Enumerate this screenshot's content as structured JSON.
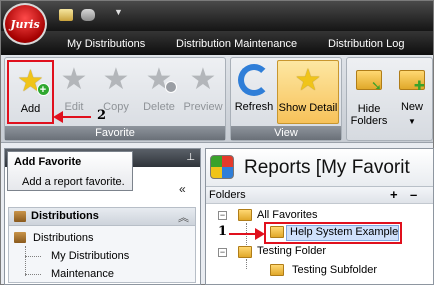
{
  "app": {
    "logo_text": "Juris"
  },
  "tabs": [
    "My Distributions",
    "Distribution Maintenance",
    "Distribution Log"
  ],
  "ribbon": {
    "favorite_group": {
      "label": "Favorite",
      "buttons": [
        {
          "label": "Add",
          "icon": "star-add-icon",
          "enabled": true
        },
        {
          "label": "Edit",
          "icon": "star-edit-icon",
          "enabled": false
        },
        {
          "label": "Copy",
          "icon": "star-copy-icon",
          "enabled": false
        },
        {
          "label": "Delete",
          "icon": "star-delete-icon",
          "enabled": false
        },
        {
          "label": "Preview",
          "icon": "star-preview-icon",
          "enabled": false
        }
      ]
    },
    "view_group": {
      "label": "View",
      "buttons": [
        {
          "label": "Refresh",
          "icon": "refresh-icon"
        },
        {
          "label": "Show Detail",
          "icon": "show-detail-icon",
          "active": true
        }
      ]
    },
    "folders_group": {
      "buttons": [
        {
          "label": "Hide Folders",
          "icon": "hide-folders-icon"
        },
        {
          "label": "New",
          "icon": "new-folder-icon"
        }
      ]
    }
  },
  "annotations": {
    "step1": "1",
    "step2": "2"
  },
  "tooltip": {
    "title": "Add Favorite",
    "text": "Add a report favorite."
  },
  "left_panel": {
    "section_title": "Distributions",
    "tree": [
      "Distributions",
      "My Distributions",
      "Maintenance"
    ]
  },
  "right_panel": {
    "title": "Reports  [My Favorit",
    "folders_label": "Folders",
    "folders_add": "+",
    "folders_remove": "–",
    "tree": {
      "root": "All Favorites",
      "selected": "Help System Example",
      "testing_folder": "Testing Folder",
      "testing_subfolder": "Testing Subfolder"
    }
  },
  "colors": {
    "annotation_red": "#e0101d",
    "ribbon_dark": "#1a1a1a",
    "accent_yellow": "#f0c419"
  }
}
